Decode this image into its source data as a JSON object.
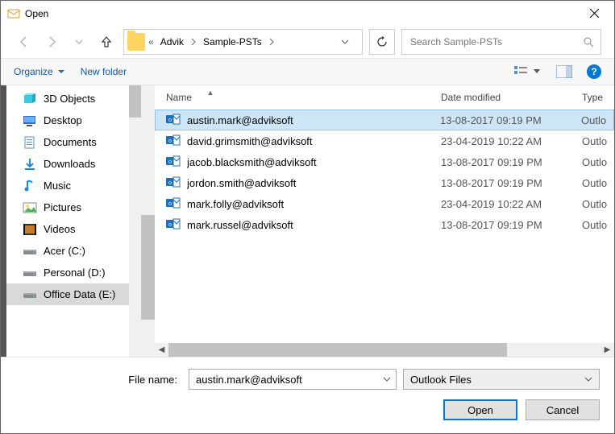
{
  "title": "Open",
  "breadcrumb": {
    "root_icon": "folder",
    "sep": "«",
    "items": [
      "Advik",
      "Sample-PSTs"
    ]
  },
  "search": {
    "placeholder": "Search Sample-PSTs"
  },
  "toolbar": {
    "organize": "Organize",
    "newfolder": "New folder"
  },
  "sidebar": {
    "items": [
      {
        "label": "3D Objects",
        "icon": "3d"
      },
      {
        "label": "Desktop",
        "icon": "desktop"
      },
      {
        "label": "Documents",
        "icon": "docs"
      },
      {
        "label": "Downloads",
        "icon": "downloads"
      },
      {
        "label": "Music",
        "icon": "music"
      },
      {
        "label": "Pictures",
        "icon": "pictures"
      },
      {
        "label": "Videos",
        "icon": "videos"
      },
      {
        "label": "Acer (C:)",
        "icon": "drive"
      },
      {
        "label": "Personal (D:)",
        "icon": "drive"
      },
      {
        "label": "Office Data (E:)",
        "icon": "drive",
        "selected": true
      }
    ]
  },
  "columns": {
    "name": "Name",
    "date": "Date modified",
    "type": "Type"
  },
  "files": [
    {
      "name": "austin.mark@adviksoft",
      "date": "13-08-2017 09:19 PM",
      "type": "Outlo",
      "selected": true
    },
    {
      "name": "david.grimsmith@adviksoft",
      "date": "23-04-2019 10:22 AM",
      "type": "Outlo"
    },
    {
      "name": "jacob.blacksmith@adviksoft",
      "date": "13-08-2017 09:19 PM",
      "type": "Outlo"
    },
    {
      "name": "jordon.smith@adviksoft",
      "date": "13-08-2017 09:19 PM",
      "type": "Outlo"
    },
    {
      "name": "mark.folly@adviksoft",
      "date": "23-04-2019 10:22 AM",
      "type": "Outlo"
    },
    {
      "name": "mark.russel@adviksoft",
      "date": "13-08-2017 09:19 PM",
      "type": "Outlo"
    }
  ],
  "filename": {
    "label": "File name:",
    "value": "austin.mark@adviksoft"
  },
  "filetype": {
    "value": "Outlook Files"
  },
  "buttons": {
    "open": "Open",
    "cancel": "Cancel"
  }
}
